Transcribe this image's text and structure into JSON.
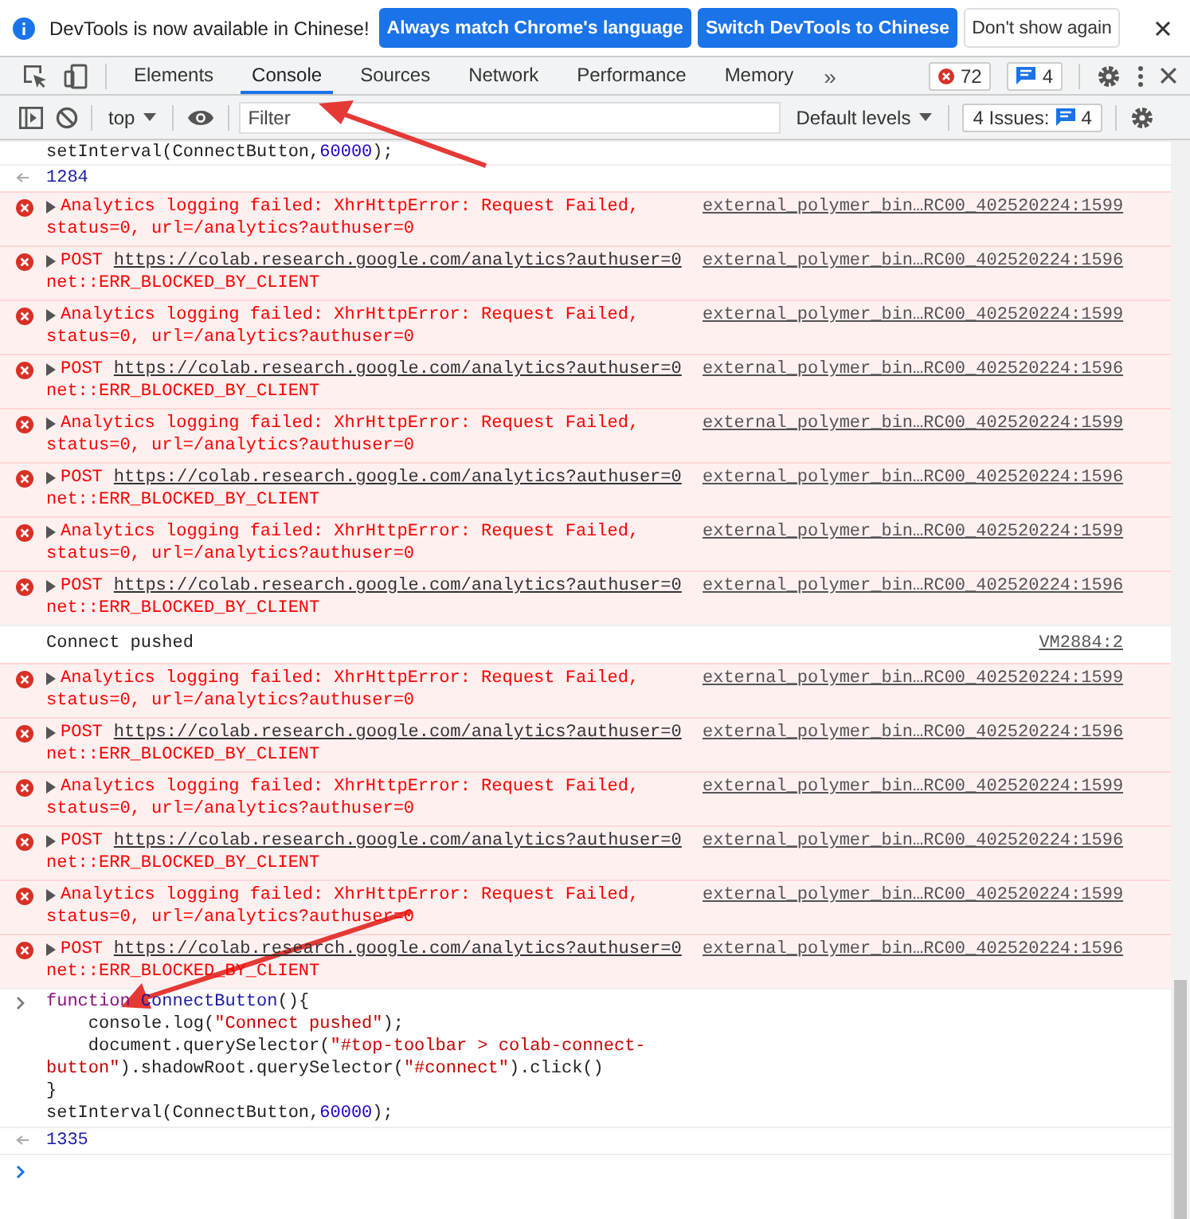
{
  "infobar": {
    "message": "DevTools is now available in Chinese!",
    "buttons": [
      {
        "label": "Always match Chrome's language",
        "primary": true
      },
      {
        "label": "Switch DevTools to Chinese",
        "primary": true
      },
      {
        "label": "Don't show again",
        "primary": false
      }
    ]
  },
  "tabs": [
    {
      "label": "Elements",
      "selected": false
    },
    {
      "label": "Console",
      "selected": true
    },
    {
      "label": "Sources",
      "selected": false
    },
    {
      "label": "Network",
      "selected": false
    },
    {
      "label": "Performance",
      "selected": false
    },
    {
      "label": "Memory",
      "selected": false
    }
  ],
  "more_tabs": "»",
  "error_count": "72",
  "message_count": "4",
  "toolbar": {
    "context": "top",
    "filter_placeholder": "Filter",
    "levels": "Default levels",
    "issues_label": "4 Issues:",
    "issues_count": "4"
  },
  "console": [
    {
      "kind": "code",
      "lines": [
        [
          {
            "t": "setInterval(ConnectButton,",
            "kind": "plain"
          },
          {
            "t": "60000",
            "kind": "number"
          },
          {
            "t": ");",
            "kind": "plain"
          }
        ]
      ]
    },
    {
      "kind": "result",
      "text": "1284"
    },
    {
      "kind": "error",
      "text": "Analytics logging failed: XhrHttpError: Request Failed,",
      "detail": "status=0, url=/analytics?authuser=0",
      "source": "external_polymer_bin…RC00_402520224:1599"
    },
    {
      "kind": "error",
      "text": "POST",
      "link": "https://colab.research.google.com/analytics?authuser=0",
      "detail": "net::ERR_BLOCKED_BY_CLIENT",
      "source": "external_polymer_bin…RC00_402520224:1596"
    },
    {
      "kind": "error",
      "text": "Analytics logging failed: XhrHttpError: Request Failed,",
      "detail": "status=0, url=/analytics?authuser=0",
      "source": "external_polymer_bin…RC00_402520224:1599"
    },
    {
      "kind": "error",
      "text": "POST",
      "link": "https://colab.research.google.com/analytics?authuser=0",
      "detail": "net::ERR_BLOCKED_BY_CLIENT",
      "source": "external_polymer_bin…RC00_402520224:1596"
    },
    {
      "kind": "error",
      "text": "Analytics logging failed: XhrHttpError: Request Failed,",
      "detail": "status=0, url=/analytics?authuser=0",
      "source": "external_polymer_bin…RC00_402520224:1599"
    },
    {
      "kind": "error",
      "text": "POST",
      "link": "https://colab.research.google.com/analytics?authuser=0",
      "detail": "net::ERR_BLOCKED_BY_CLIENT",
      "source": "external_polymer_bin…RC00_402520224:1596"
    },
    {
      "kind": "error",
      "text": "Analytics logging failed: XhrHttpError: Request Failed,",
      "detail": "status=0, url=/analytics?authuser=0",
      "source": "external_polymer_bin…RC00_402520224:1599"
    },
    {
      "kind": "error",
      "text": "POST",
      "link": "https://colab.research.google.com/analytics?authuser=0",
      "detail": "net::ERR_BLOCKED_BY_CLIENT",
      "source": "external_polymer_bin…RC00_402520224:1596"
    },
    {
      "kind": "log",
      "text": "Connect pushed",
      "source": "VM2884:2"
    },
    {
      "kind": "error",
      "text": "Analytics logging failed: XhrHttpError: Request Failed,",
      "detail": "status=0, url=/analytics?authuser=0",
      "source": "external_polymer_bin…RC00_402520224:1599"
    },
    {
      "kind": "error",
      "text": "POST",
      "link": "https://colab.research.google.com/analytics?authuser=0",
      "detail": "net::ERR_BLOCKED_BY_CLIENT",
      "source": "external_polymer_bin…RC00_402520224:1596"
    },
    {
      "kind": "error",
      "text": "Analytics logging failed: XhrHttpError: Request Failed,",
      "detail": "status=0, url=/analytics?authuser=0",
      "source": "external_polymer_bin…RC00_402520224:1599"
    },
    {
      "kind": "error",
      "text": "POST",
      "link": "https://colab.research.google.com/analytics?authuser=0",
      "detail": "net::ERR_BLOCKED_BY_CLIENT",
      "source": "external_polymer_bin…RC00_402520224:1596"
    },
    {
      "kind": "error",
      "text": "Analytics logging failed: XhrHttpError: Request Failed,",
      "detail": "status=0, url=/analytics?authuser=0",
      "source": "external_polymer_bin…RC00_402520224:1599"
    },
    {
      "kind": "error",
      "text": "POST",
      "link": "https://colab.research.google.com/analytics?authuser=0",
      "detail": "net::ERR_BLOCKED_BY_CLIENT",
      "source": "external_polymer_bin…RC00_402520224:1596"
    },
    {
      "kind": "input",
      "lines": [
        [
          {
            "t": "function ",
            "kind": "keyword"
          },
          {
            "t": "ConnectButton",
            "kind": "name"
          },
          {
            "t": "(){",
            "kind": "plain"
          }
        ],
        [
          {
            "t": "    console.log(",
            "kind": "plain"
          },
          {
            "t": "\"Connect pushed\"",
            "kind": "string"
          },
          {
            "t": ");",
            "kind": "plain"
          }
        ],
        [
          {
            "t": "    document.querySelector(",
            "kind": "plain"
          },
          {
            "t": "\"#top-toolbar > colab-connect-button\"",
            "kind": "string"
          },
          {
            "t": ").shadowRoot.querySelector(",
            "kind": "plain"
          },
          {
            "t": "\"#connect\"",
            "kind": "string"
          },
          {
            "t": ").click()",
            "kind": "plain"
          }
        ],
        [
          {
            "t": "}",
            "kind": "plain"
          }
        ],
        [
          {
            "t": "setInterval(ConnectButton,",
            "kind": "plain"
          },
          {
            "t": "60000",
            "kind": "number"
          },
          {
            "t": ");",
            "kind": "plain"
          }
        ]
      ]
    },
    {
      "kind": "result",
      "text": "1335"
    },
    {
      "kind": "prompt"
    }
  ]
}
